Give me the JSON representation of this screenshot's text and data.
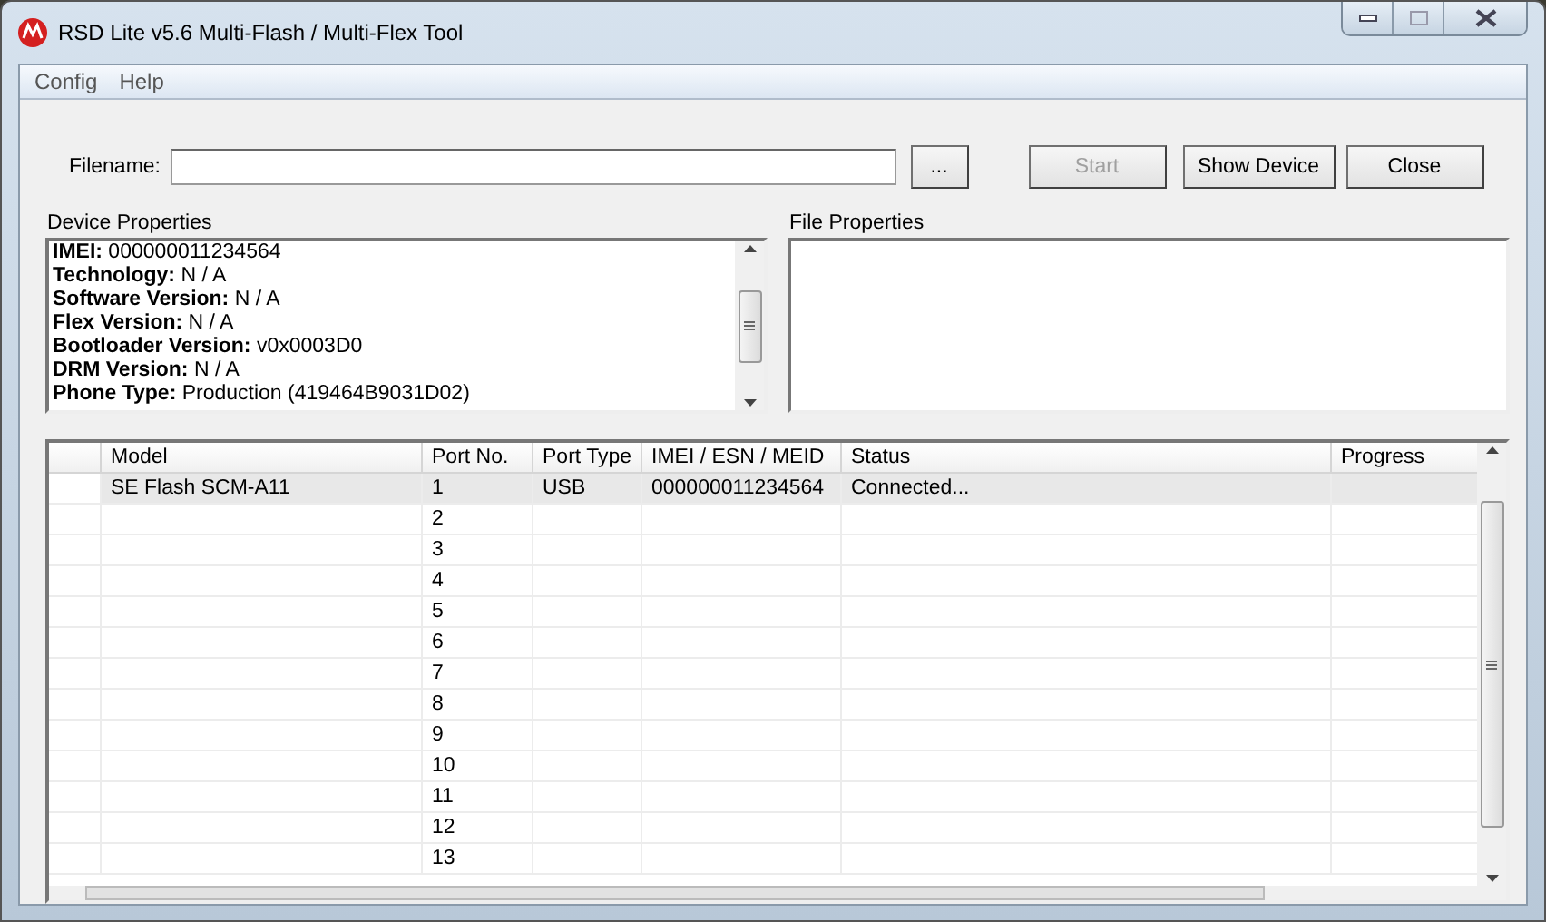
{
  "window": {
    "title": "RSD Lite v5.6 Multi-Flash / Multi-Flex Tool"
  },
  "menu": [
    "Config",
    "Help"
  ],
  "filename": {
    "label": "Filename:"
  },
  "buttons": [
    {
      "label": "...",
      "disabled": false
    },
    {
      "label": "Start",
      "disabled": true
    },
    {
      "label": "Show Device",
      "disabled": false
    },
    {
      "label": "Close",
      "disabled": false
    }
  ],
  "device_properties": {
    "title": "Device Properties",
    "lines": [
      "**IMEI:** 000000011234564",
      "**Technology:** N / A",
      "**Software Version:** N / A",
      "**Flex Version:** N / A",
      "**Bootloader Version:** v0x0003D0",
      "**DRM Version:** N / A",
      "**Phone Type:** Production (419464B9031D02)"
    ]
  },
  "file_properties": {
    "title": "File Properties"
  },
  "table": {
    "columns": [
      "",
      "Model",
      "Port No.",
      "Port Type",
      "IMEI / ESN / MEID",
      "Status",
      "Progress"
    ],
    "rows": [
      {
        "selected": true,
        "cells": [
          "",
          "SE Flash SCM-A11",
          "1",
          "USB",
          "000000011234564",
          "Connected...",
          ""
        ]
      },
      {
        "selected": false,
        "cells": [
          "",
          "",
          "2",
          "",
          "",
          "",
          ""
        ]
      },
      {
        "selected": false,
        "cells": [
          "",
          "",
          "3",
          "",
          "",
          "",
          ""
        ]
      },
      {
        "selected": false,
        "cells": [
          "",
          "",
          "4",
          "",
          "",
          "",
          ""
        ]
      },
      {
        "selected": false,
        "cells": [
          "",
          "",
          "5",
          "",
          "",
          "",
          ""
        ]
      },
      {
        "selected": false,
        "cells": [
          "",
          "",
          "6",
          "",
          "",
          "",
          ""
        ]
      },
      {
        "selected": false,
        "cells": [
          "",
          "",
          "7",
          "",
          "",
          "",
          ""
        ]
      },
      {
        "selected": false,
        "cells": [
          "",
          "",
          "8",
          "",
          "",
          "",
          ""
        ]
      },
      {
        "selected": false,
        "cells": [
          "",
          "",
          "9",
          "",
          "",
          "",
          ""
        ]
      },
      {
        "selected": false,
        "cells": [
          "",
          "",
          "10",
          "",
          "",
          "",
          ""
        ]
      },
      {
        "selected": false,
        "cells": [
          "",
          "",
          "11",
          "",
          "",
          "",
          ""
        ]
      },
      {
        "selected": false,
        "cells": [
          "",
          "",
          "12",
          "",
          "",
          "",
          ""
        ]
      },
      {
        "selected": false,
        "cells": [
          "",
          "",
          "13",
          "",
          "",
          "",
          ""
        ]
      }
    ]
  }
}
